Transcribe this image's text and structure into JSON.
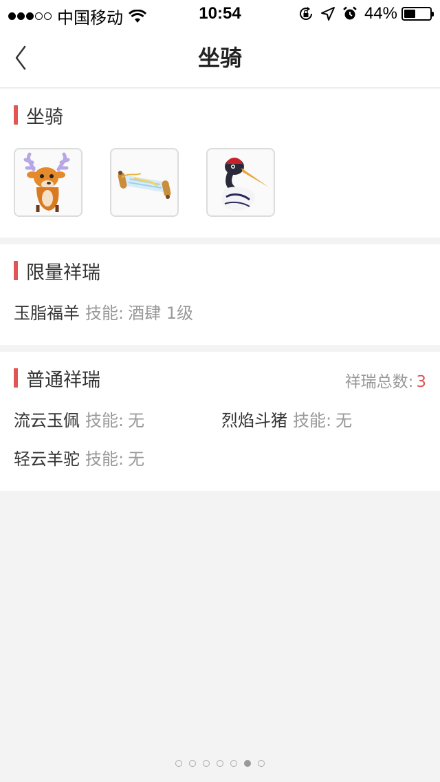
{
  "status_bar": {
    "carrier": "中国移动",
    "time": "10:54",
    "battery_percent": "44%",
    "battery_level": 0.44,
    "signal_bars_filled": 3,
    "signal_bars_total": 5
  },
  "nav": {
    "title": "坐骑"
  },
  "mounts": {
    "title": "坐骑",
    "items": [
      {
        "icon": "deer-mount-icon"
      },
      {
        "icon": "scroll-mount-icon"
      },
      {
        "icon": "crane-mount-icon"
      }
    ]
  },
  "limited": {
    "title": "限量祥瑞",
    "items": [
      {
        "name": "玉脂福羊",
        "skill_label": "技能:",
        "skill_value": "酒肆 1级"
      }
    ]
  },
  "normal": {
    "title": "普通祥瑞",
    "total_label": "祥瑞总数:",
    "total_count": "3",
    "items": [
      {
        "name": "流云玉佩",
        "skill_label": "技能:",
        "skill_value": "无"
      },
      {
        "name": "烈焰斗猪",
        "skill_label": "技能:",
        "skill_value": "无"
      },
      {
        "name": "轻云羊驼",
        "skill_label": "技能:",
        "skill_value": "无"
      }
    ]
  },
  "pager": {
    "total": 7,
    "active_index": 5
  },
  "colors": {
    "accent": "#e05555",
    "muted_text": "#999999",
    "background": "#f3f3f3"
  }
}
